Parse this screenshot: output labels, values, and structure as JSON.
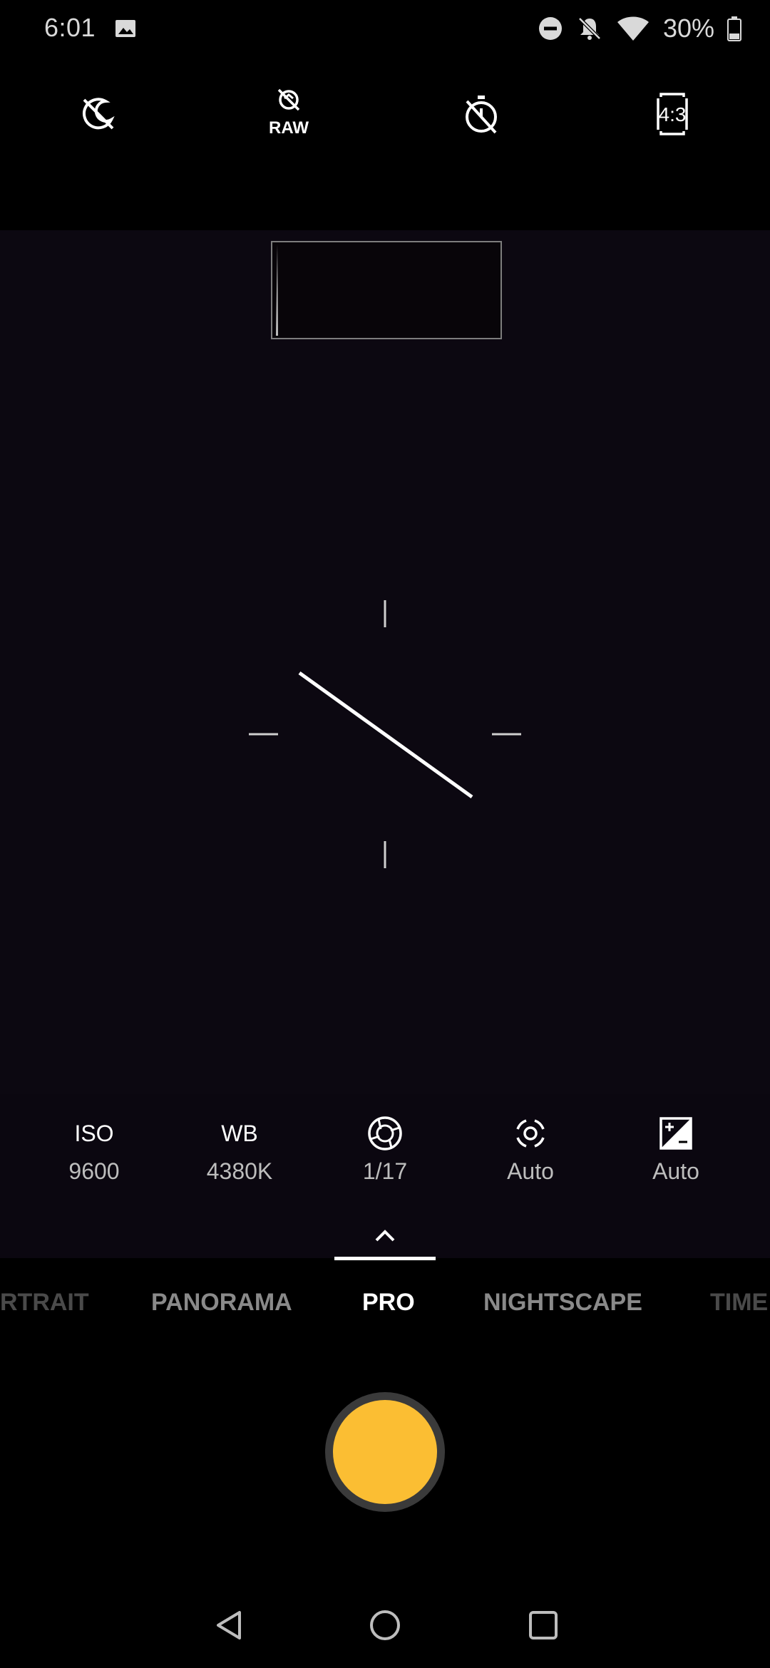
{
  "status_bar": {
    "time": "6:01",
    "battery": "30%",
    "icons": [
      "gallery-icon",
      "dnd-icon",
      "bell-off-icon",
      "wifi-icon",
      "battery-icon"
    ]
  },
  "top_toolbar": {
    "icons": [
      "hdr-off-icon",
      "raw-off-icon",
      "timer-off-icon",
      "aspect-ratio-icon"
    ],
    "raw_label": "RAW",
    "aspect_label": "4:3"
  },
  "pro_controls": {
    "iso": {
      "label": "ISO",
      "value": "9600"
    },
    "wb": {
      "label": "WB",
      "value": "4380K"
    },
    "shutter_speed": {
      "icon": "shutter-speed-icon",
      "value": "1/17"
    },
    "focus": {
      "icon": "focus-icon",
      "value": "Auto"
    },
    "exposure": {
      "icon": "exposure-icon",
      "value": "Auto"
    }
  },
  "modes": {
    "items": [
      "RTRAIT",
      "PANORAMA",
      "PRO",
      "NIGHTSCAPE",
      "TIME"
    ],
    "active": "PRO"
  },
  "colors": {
    "shutter": "#fbbe33",
    "viewfinder": "#0c0811"
  },
  "nav_bar": {
    "icons": [
      "back-icon",
      "home-icon",
      "recents-icon"
    ]
  }
}
